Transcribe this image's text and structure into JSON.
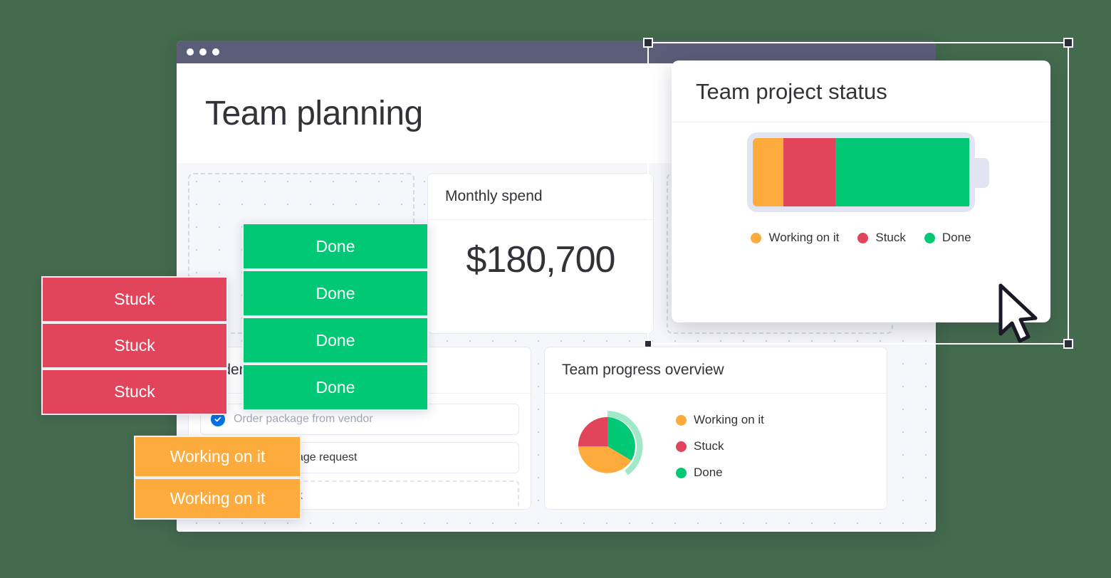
{
  "window": {
    "title": "Team planning",
    "traffic_lights": [
      "close-dot",
      "minimize-dot",
      "maximize-dot"
    ]
  },
  "cards": {
    "monthly_spend": {
      "title": "Monthly spend",
      "value": "$180,700"
    },
    "order_list": {
      "title": "Order list",
      "tasks": [
        {
          "label": "Order package from vendor",
          "state": "checked"
        },
        {
          "label": "Send a package request",
          "state": "unchecked"
        },
        {
          "label": "Add new task",
          "state": "add"
        }
      ]
    },
    "team_progress": {
      "title": "Team progress overview"
    },
    "team_project_status": {
      "title": "Team project status"
    }
  },
  "legend": [
    {
      "label": "Working on it",
      "color": "#FDAB3D"
    },
    {
      "label": "Stuck",
      "color": "#E2445C"
    },
    {
      "label": "Done",
      "color": "#00C875"
    }
  ],
  "chip_stacks": {
    "stuck": {
      "label": "Stuck",
      "color": "#E2445C",
      "count": 3
    },
    "done": {
      "label": "Done",
      "color": "#00C875",
      "count": 4
    },
    "working": {
      "label": "Working on it",
      "color": "#FDAB3D",
      "count": 2
    }
  },
  "colors": {
    "working_on_it": "#FDAB3D",
    "stuck": "#E2445C",
    "done": "#00C875",
    "done_highlight": "#A0E8C6",
    "titlebar": "#5B5C77",
    "canvas": "#F6F7FB",
    "backdrop": "#446B4E",
    "text": "#323338",
    "check_blue": "#0073EA"
  },
  "chart_data": [
    {
      "type": "bar",
      "variant": "stacked-horizontal-battery",
      "title": "Team project status",
      "categories": [
        "Working on it",
        "Stuck",
        "Done"
      ],
      "values": [
        14,
        24,
        62
      ],
      "value_unit": "percent",
      "colors": [
        "#FDAB3D",
        "#E2445C",
        "#00C875"
      ],
      "legend_position": "bottom",
      "grid": false,
      "xlabel": "",
      "ylabel": ""
    },
    {
      "type": "pie",
      "title": "Team progress overview",
      "categories": [
        "Working on it",
        "Stuck",
        "Done"
      ],
      "values": [
        40,
        25,
        35
      ],
      "value_unit": "percent",
      "colors": [
        "#FDAB3D",
        "#E2445C",
        "#00C875"
      ],
      "highlighted_slice": "Done",
      "highlight_color": "#A0E8C6",
      "legend_position": "right",
      "grid": false
    }
  ]
}
